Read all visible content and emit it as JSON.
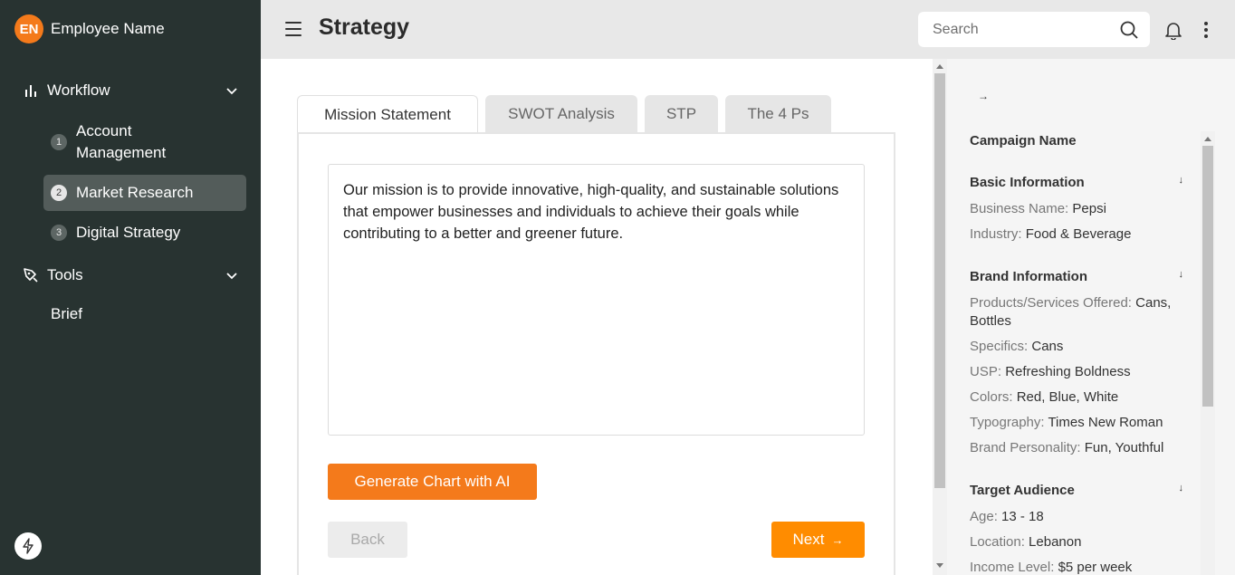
{
  "sidebar": {
    "avatar_initials": "EN",
    "user_name": "Employee Name",
    "workflow_label": "Workflow",
    "steps": [
      {
        "num": "1",
        "label": "Account Management"
      },
      {
        "num": "2",
        "label": "Market Research"
      },
      {
        "num": "3",
        "label": "Digital Strategy"
      }
    ],
    "tools_label": "Tools",
    "brief_label": "Brief"
  },
  "header": {
    "title": "Strategy",
    "search_placeholder": "Search"
  },
  "tabs": [
    "Mission Statement",
    "SWOT Analysis",
    "STP",
    "The 4 Ps"
  ],
  "main": {
    "mission_text": "Our mission is to provide innovative, high-quality, and sustainable solutions that empower businesses and individuals to achieve their goals while contributing to a better and greener future.",
    "generate_label": "Generate Chart with AI",
    "back_label": "Back",
    "next_label": "Next"
  },
  "panel": {
    "campaign_name": "Campaign Name",
    "sections": [
      {
        "title": "Basic Information",
        "fields": [
          {
            "label": "Business Name: ",
            "value": "Pepsi"
          },
          {
            "label": "Industry: ",
            "value": "Food & Beverage"
          }
        ]
      },
      {
        "title": "Brand Information",
        "fields": [
          {
            "label": "Products/Services Offered: ",
            "value": "Cans, Bottles"
          },
          {
            "label": "Specifics: ",
            "value": "Cans"
          },
          {
            "label": "USP: ",
            "value": "Refreshing Boldness"
          },
          {
            "label": "Colors: ",
            "value": "Red, Blue, White"
          },
          {
            "label": "Typography: ",
            "value": "Times New Roman"
          },
          {
            "label": "Brand Personality: ",
            "value": "Fun, Youthful"
          }
        ]
      },
      {
        "title": "Target Audience",
        "fields": [
          {
            "label": "Age: ",
            "value": "13 - 18"
          },
          {
            "label": "Location: ",
            "value": "Lebanon"
          },
          {
            "label": "Income Level: ",
            "value": "$5 per week"
          }
        ]
      }
    ]
  },
  "colors": {
    "sidebar_bg": "#283331",
    "accent": "#f47a1b",
    "next_button": "#ff8c00"
  },
  "icons": [
    "bar-chart-icon",
    "chevron-down-icon",
    "pen-tool-icon",
    "lightning-icon",
    "hamburger-icon",
    "search-icon",
    "bell-icon",
    "more-vertical-icon",
    "arrow-right-icon",
    "arrow-down-icon"
  ]
}
